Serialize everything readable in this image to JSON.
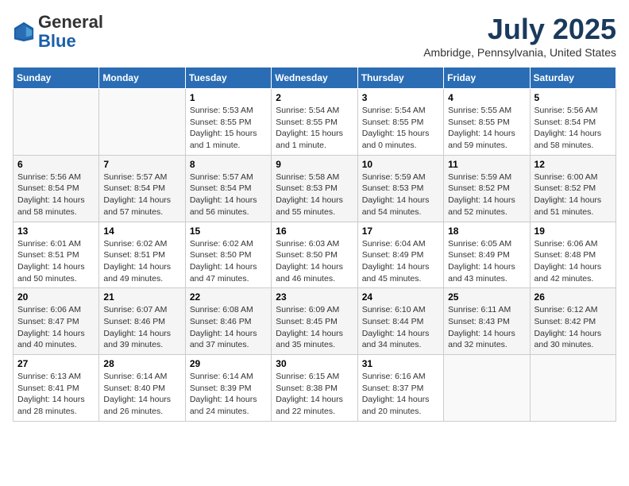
{
  "header": {
    "logo_general": "General",
    "logo_blue": "Blue",
    "month": "July 2025",
    "location": "Ambridge, Pennsylvania, United States"
  },
  "weekdays": [
    "Sunday",
    "Monday",
    "Tuesday",
    "Wednesday",
    "Thursday",
    "Friday",
    "Saturday"
  ],
  "weeks": [
    [
      {
        "day": "",
        "info": ""
      },
      {
        "day": "",
        "info": ""
      },
      {
        "day": "1",
        "info": "Sunrise: 5:53 AM\nSunset: 8:55 PM\nDaylight: 15 hours\nand 1 minute."
      },
      {
        "day": "2",
        "info": "Sunrise: 5:54 AM\nSunset: 8:55 PM\nDaylight: 15 hours\nand 1 minute."
      },
      {
        "day": "3",
        "info": "Sunrise: 5:54 AM\nSunset: 8:55 PM\nDaylight: 15 hours\nand 0 minutes."
      },
      {
        "day": "4",
        "info": "Sunrise: 5:55 AM\nSunset: 8:55 PM\nDaylight: 14 hours\nand 59 minutes."
      },
      {
        "day": "5",
        "info": "Sunrise: 5:56 AM\nSunset: 8:54 PM\nDaylight: 14 hours\nand 58 minutes."
      }
    ],
    [
      {
        "day": "6",
        "info": "Sunrise: 5:56 AM\nSunset: 8:54 PM\nDaylight: 14 hours\nand 58 minutes."
      },
      {
        "day": "7",
        "info": "Sunrise: 5:57 AM\nSunset: 8:54 PM\nDaylight: 14 hours\nand 57 minutes."
      },
      {
        "day": "8",
        "info": "Sunrise: 5:57 AM\nSunset: 8:54 PM\nDaylight: 14 hours\nand 56 minutes."
      },
      {
        "day": "9",
        "info": "Sunrise: 5:58 AM\nSunset: 8:53 PM\nDaylight: 14 hours\nand 55 minutes."
      },
      {
        "day": "10",
        "info": "Sunrise: 5:59 AM\nSunset: 8:53 PM\nDaylight: 14 hours\nand 54 minutes."
      },
      {
        "day": "11",
        "info": "Sunrise: 5:59 AM\nSunset: 8:52 PM\nDaylight: 14 hours\nand 52 minutes."
      },
      {
        "day": "12",
        "info": "Sunrise: 6:00 AM\nSunset: 8:52 PM\nDaylight: 14 hours\nand 51 minutes."
      }
    ],
    [
      {
        "day": "13",
        "info": "Sunrise: 6:01 AM\nSunset: 8:51 PM\nDaylight: 14 hours\nand 50 minutes."
      },
      {
        "day": "14",
        "info": "Sunrise: 6:02 AM\nSunset: 8:51 PM\nDaylight: 14 hours\nand 49 minutes."
      },
      {
        "day": "15",
        "info": "Sunrise: 6:02 AM\nSunset: 8:50 PM\nDaylight: 14 hours\nand 47 minutes."
      },
      {
        "day": "16",
        "info": "Sunrise: 6:03 AM\nSunset: 8:50 PM\nDaylight: 14 hours\nand 46 minutes."
      },
      {
        "day": "17",
        "info": "Sunrise: 6:04 AM\nSunset: 8:49 PM\nDaylight: 14 hours\nand 45 minutes."
      },
      {
        "day": "18",
        "info": "Sunrise: 6:05 AM\nSunset: 8:49 PM\nDaylight: 14 hours\nand 43 minutes."
      },
      {
        "day": "19",
        "info": "Sunrise: 6:06 AM\nSunset: 8:48 PM\nDaylight: 14 hours\nand 42 minutes."
      }
    ],
    [
      {
        "day": "20",
        "info": "Sunrise: 6:06 AM\nSunset: 8:47 PM\nDaylight: 14 hours\nand 40 minutes."
      },
      {
        "day": "21",
        "info": "Sunrise: 6:07 AM\nSunset: 8:46 PM\nDaylight: 14 hours\nand 39 minutes."
      },
      {
        "day": "22",
        "info": "Sunrise: 6:08 AM\nSunset: 8:46 PM\nDaylight: 14 hours\nand 37 minutes."
      },
      {
        "day": "23",
        "info": "Sunrise: 6:09 AM\nSunset: 8:45 PM\nDaylight: 14 hours\nand 35 minutes."
      },
      {
        "day": "24",
        "info": "Sunrise: 6:10 AM\nSunset: 8:44 PM\nDaylight: 14 hours\nand 34 minutes."
      },
      {
        "day": "25",
        "info": "Sunrise: 6:11 AM\nSunset: 8:43 PM\nDaylight: 14 hours\nand 32 minutes."
      },
      {
        "day": "26",
        "info": "Sunrise: 6:12 AM\nSunset: 8:42 PM\nDaylight: 14 hours\nand 30 minutes."
      }
    ],
    [
      {
        "day": "27",
        "info": "Sunrise: 6:13 AM\nSunset: 8:41 PM\nDaylight: 14 hours\nand 28 minutes."
      },
      {
        "day": "28",
        "info": "Sunrise: 6:14 AM\nSunset: 8:40 PM\nDaylight: 14 hours\nand 26 minutes."
      },
      {
        "day": "29",
        "info": "Sunrise: 6:14 AM\nSunset: 8:39 PM\nDaylight: 14 hours\nand 24 minutes."
      },
      {
        "day": "30",
        "info": "Sunrise: 6:15 AM\nSunset: 8:38 PM\nDaylight: 14 hours\nand 22 minutes."
      },
      {
        "day": "31",
        "info": "Sunrise: 6:16 AM\nSunset: 8:37 PM\nDaylight: 14 hours\nand 20 minutes."
      },
      {
        "day": "",
        "info": ""
      },
      {
        "day": "",
        "info": ""
      }
    ]
  ]
}
